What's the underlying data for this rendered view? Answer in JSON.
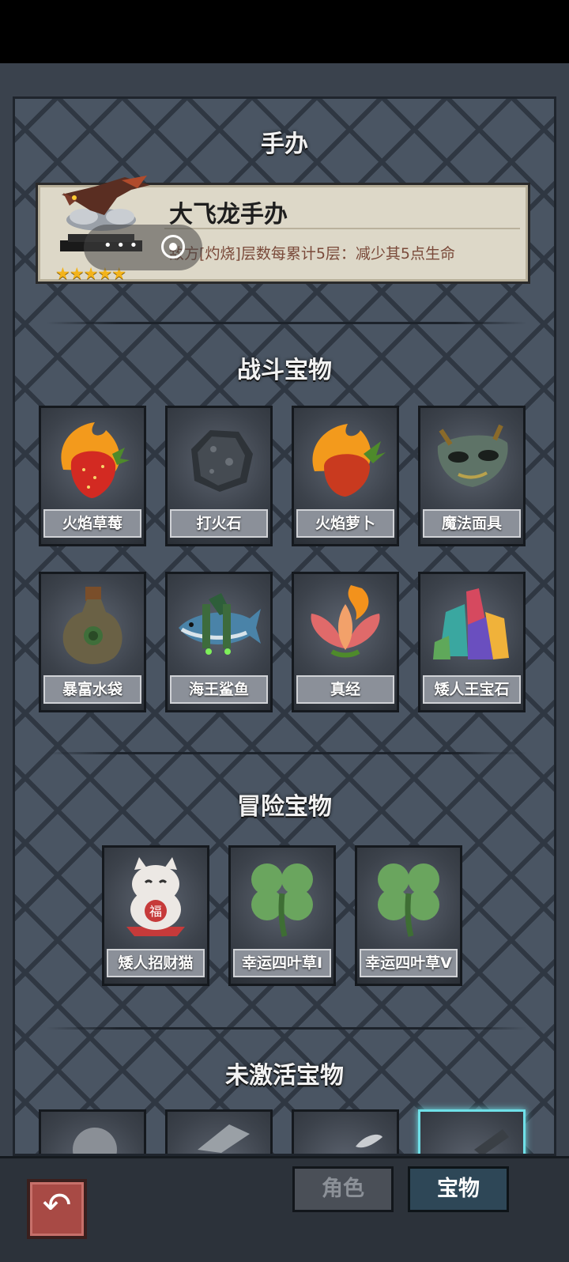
{
  "figure_section": {
    "title": "手办",
    "figure_name": "大飞龙手办",
    "description": "敌方[灼烧]层数每累计5层：减少其5点生命",
    "stars": "★★★★★"
  },
  "combat_section": {
    "title": "战斗宝物",
    "items": [
      {
        "label": "火焰草莓",
        "icon": "flaming-strawberry-icon"
      },
      {
        "label": "打火石",
        "icon": "flint-stone-icon"
      },
      {
        "label": "火焰萝卜",
        "icon": "flaming-radish-icon"
      },
      {
        "label": "魔法面具",
        "icon": "magic-mask-icon"
      },
      {
        "label": "暴富水袋",
        "icon": "water-bag-icon"
      },
      {
        "label": "海王鲨鱼",
        "icon": "shark-icon"
      },
      {
        "label": "真经",
        "icon": "lotus-flame-icon"
      },
      {
        "label": "矮人王宝石",
        "icon": "crystal-gem-icon"
      }
    ]
  },
  "adventure_section": {
    "title": "冒险宝物",
    "items": [
      {
        "label": "矮人招财猫",
        "icon": "lucky-cat-icon"
      },
      {
        "label": "幸运四叶草I",
        "icon": "four-leaf-clover-icon"
      },
      {
        "label": "幸运四叶草V",
        "icon": "four-leaf-clover-icon"
      }
    ]
  },
  "inactive_section": {
    "title": "未激活宝物"
  },
  "bottom_bar": {
    "tab_character": "角色",
    "tab_treasure": "宝物",
    "back_icon": "back-arrow-icon"
  },
  "colors": {
    "panel_bg": "#4a5563",
    "card_bg": "#ddd8c8",
    "star": "#f3b31a",
    "active_tab": "#2e4757",
    "highlight": "#6fe0e8"
  }
}
